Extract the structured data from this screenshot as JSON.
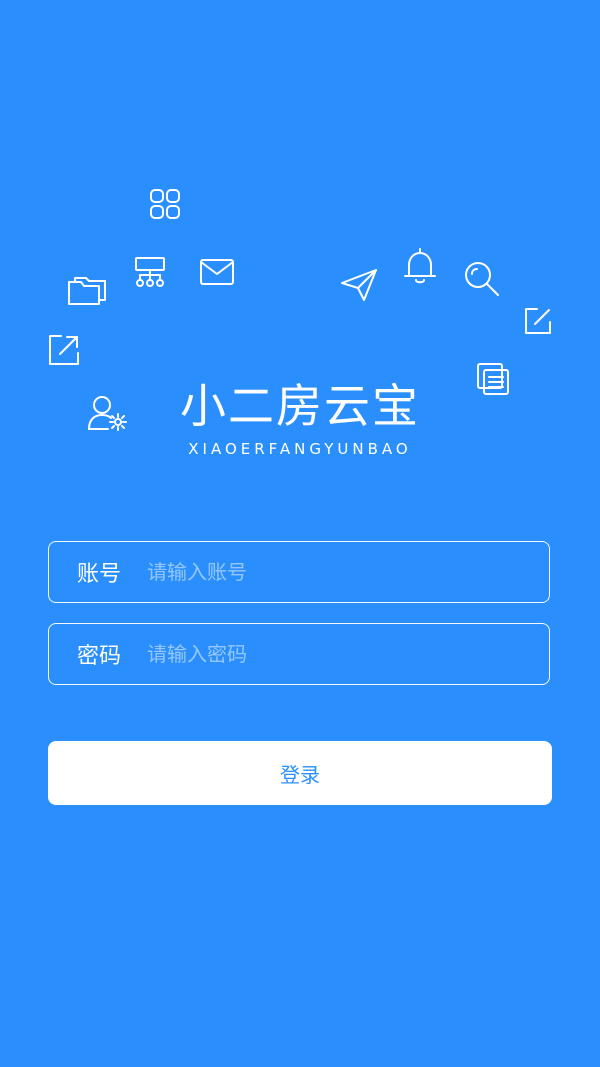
{
  "brand": {
    "title": "小二房云宝",
    "subtitle": "XIAOERFANGYUNBAO"
  },
  "decor_icons": [
    "grid-icon",
    "sitemap-icon",
    "mail-icon",
    "folder-icon",
    "external-link-icon",
    "user-settings-icon",
    "send-icon",
    "bell-icon",
    "search-icon",
    "edit-icon",
    "documents-icon"
  ],
  "form": {
    "account": {
      "label": "账号",
      "placeholder": "请输入账号",
      "value": ""
    },
    "password": {
      "label": "密码",
      "placeholder": "请输入密码",
      "value": ""
    },
    "login_label": "登录"
  },
  "colors": {
    "background": "#2a8ffd",
    "button_text": "#2a8ffd",
    "button_bg": "#ffffff"
  }
}
